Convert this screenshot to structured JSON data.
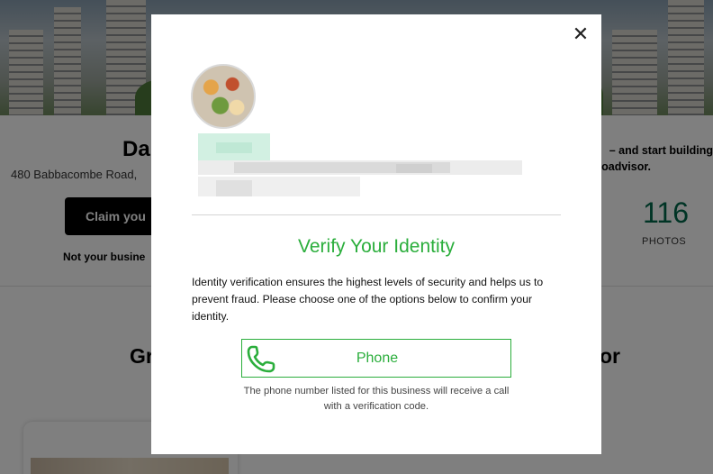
{
  "background": {
    "business_name": "Da",
    "address": "480 Babbacombe Road,",
    "claim_button": "Claim you",
    "not_your_business": "Not your busine",
    "promo_line1": "– and start building",
    "promo_line2": "oadvisor.",
    "photo_count": "116",
    "photo_label": "PHOTOS",
    "heading_left": "Gr",
    "heading_right": "or"
  },
  "modal": {
    "close_glyph": "✕",
    "title": "Verify Your Identity",
    "description": "Identity verification ensures the highest levels of security and helps us to prevent fraud. Please choose one of the options below to confirm your identity.",
    "options": [
      {
        "label": "Phone",
        "icon": "phone-icon",
        "note": "The phone number listed for this business will receive a call with a verification code."
      }
    ]
  },
  "colors": {
    "accent_green": "#2bae3c",
    "tripadvisor_green": "#00684a",
    "overlay": "rgba(0,0,0,0.5)"
  }
}
